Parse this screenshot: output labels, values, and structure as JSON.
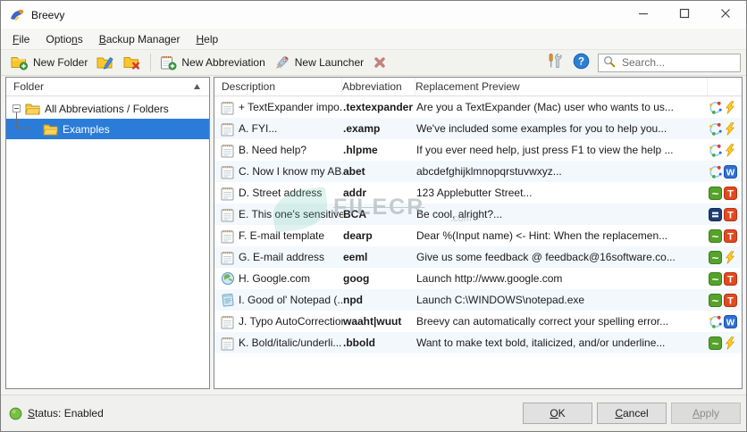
{
  "window": {
    "title": "Breevy"
  },
  "titlebar": {
    "controls": [
      "minimize",
      "maximize",
      "close"
    ]
  },
  "menu": {
    "items": [
      {
        "name": "file",
        "pre": "",
        "key": "F",
        "post": "ile"
      },
      {
        "name": "options",
        "pre": "Optio",
        "key": "n",
        "post": "s"
      },
      {
        "name": "backup-manager",
        "pre": "",
        "key": "B",
        "post": "ackup Manager"
      },
      {
        "name": "help",
        "pre": "",
        "key": "H",
        "post": "elp"
      }
    ]
  },
  "toolbar": {
    "new_folder": {
      "label": "New Folder",
      "icon": "folder-plus"
    },
    "edit_folder": {
      "icon": "folder-edit"
    },
    "delete_folder": {
      "icon": "folder-delete"
    },
    "new_abbreviation": {
      "label": "New Abbreviation",
      "icon": "note-plus"
    },
    "new_launcher": {
      "label": "New Launcher",
      "icon": "rocket"
    },
    "delete_abbreviation": {
      "icon": "delete-x"
    },
    "settings": {
      "icon": "tools"
    },
    "help": {
      "icon": "help"
    },
    "search": {
      "placeholder": "Search...",
      "icon": "search"
    }
  },
  "sidebar": {
    "header": "Folder",
    "sort_order": "ascending",
    "items": [
      {
        "label": "All Abbreviations / Folders",
        "icon": "folder-yellow",
        "expanded": true,
        "selected": false
      },
      {
        "label": "Examples",
        "icon": "folder-yellow",
        "expanded": false,
        "selected": true
      }
    ]
  },
  "table": {
    "columns": [
      "Description",
      "Abbreviation",
      "Replacement Preview"
    ],
    "rows": [
      {
        "icon": "memo",
        "description": "+ TextExpander impo...",
        "abbreviation": ".textexpander",
        "preview": "Are you a TextExpander (Mac) user who wants to us...",
        "badges": [
          "sync",
          "bolt"
        ]
      },
      {
        "icon": "memo",
        "description": "A. FYI...",
        "abbreviation": ".examp",
        "preview": "We've included some examples for you to help you...",
        "badges": [
          "sync",
          "bolt"
        ]
      },
      {
        "icon": "memo",
        "description": "B. Need help?",
        "abbreviation": ".hlpme",
        "preview": "If you ever need help, just press F1 to view the help ...",
        "badges": [
          "sync",
          "bolt"
        ]
      },
      {
        "icon": "memo",
        "description": "C. Now I know my AB...",
        "abbreviation": "abet",
        "preview": "abcdefghijklmnopqrstuvwxyz...",
        "badges": [
          "sync",
          "w"
        ]
      },
      {
        "icon": "memo",
        "description": "D. Street address",
        "abbreviation": "addr",
        "preview": "123 Applebutter Street...",
        "badges": [
          "tilde",
          "t"
        ]
      },
      {
        "icon": "memo",
        "description": "E. This one's sensitive!",
        "abbreviation": "BCA",
        "preview": "Be cool, alright?...",
        "badges": [
          "eq",
          "t"
        ]
      },
      {
        "icon": "memo",
        "description": "F. E-mail template",
        "abbreviation": "dearp",
        "preview": "Dear %(Input name) <- Hint: When the replacemen...",
        "badges": [
          "tilde",
          "t"
        ]
      },
      {
        "icon": "memo",
        "description": "G. E-mail address",
        "abbreviation": "eeml",
        "preview": "Give us some feedback @ feedback@16software.co...",
        "badges": [
          "tilde",
          "bolt"
        ]
      },
      {
        "icon": "globe",
        "description": "H. Google.com",
        "abbreviation": "goog",
        "preview": "Launch http://www.google.com",
        "badges": [
          "tilde",
          "t"
        ]
      },
      {
        "icon": "notepad",
        "description": "I. Good ol' Notepad (...",
        "abbreviation": "npd",
        "preview": "Launch C:\\WINDOWS\\notepad.exe",
        "badges": [
          "tilde",
          "t"
        ]
      },
      {
        "icon": "memo",
        "description": "J. Typo AutoCorrection",
        "abbreviation": "waaht|wuut",
        "preview": "Breevy can automatically correct your spelling error...",
        "badges": [
          "sync",
          "w"
        ]
      },
      {
        "icon": "memo",
        "description": "K. Bold/italic/underli...",
        "abbreviation": ".bbold",
        "preview": "Want to make text bold, italicized, and/or underline...",
        "badges": [
          "tilde",
          "bolt"
        ]
      }
    ]
  },
  "statusbar": {
    "status": {
      "pre": "",
      "key": "S",
      "post": "tatus: Enabled",
      "indicator_color": "#76c043"
    },
    "buttons": {
      "ok": {
        "key": "O",
        "post": "K",
        "enabled": true
      },
      "cancel": {
        "key": "C",
        "post": "ancel",
        "enabled": true
      },
      "apply": {
        "key": "A",
        "post": "pply",
        "enabled": false
      }
    }
  },
  "watermark": {
    "brand": "FILECR",
    "suffix": ".com"
  },
  "colors": {
    "selection_blue": "#2b7cd9",
    "row_alt_tint": "#f3f8fd",
    "badge_green": "#55a32a",
    "badge_red_orange": "#e2491f",
    "badge_blue": "#2e6fd4",
    "badge_navy": "#1c3e76",
    "lightning_yellow": "#fdd023",
    "status_green": "#76c043"
  }
}
